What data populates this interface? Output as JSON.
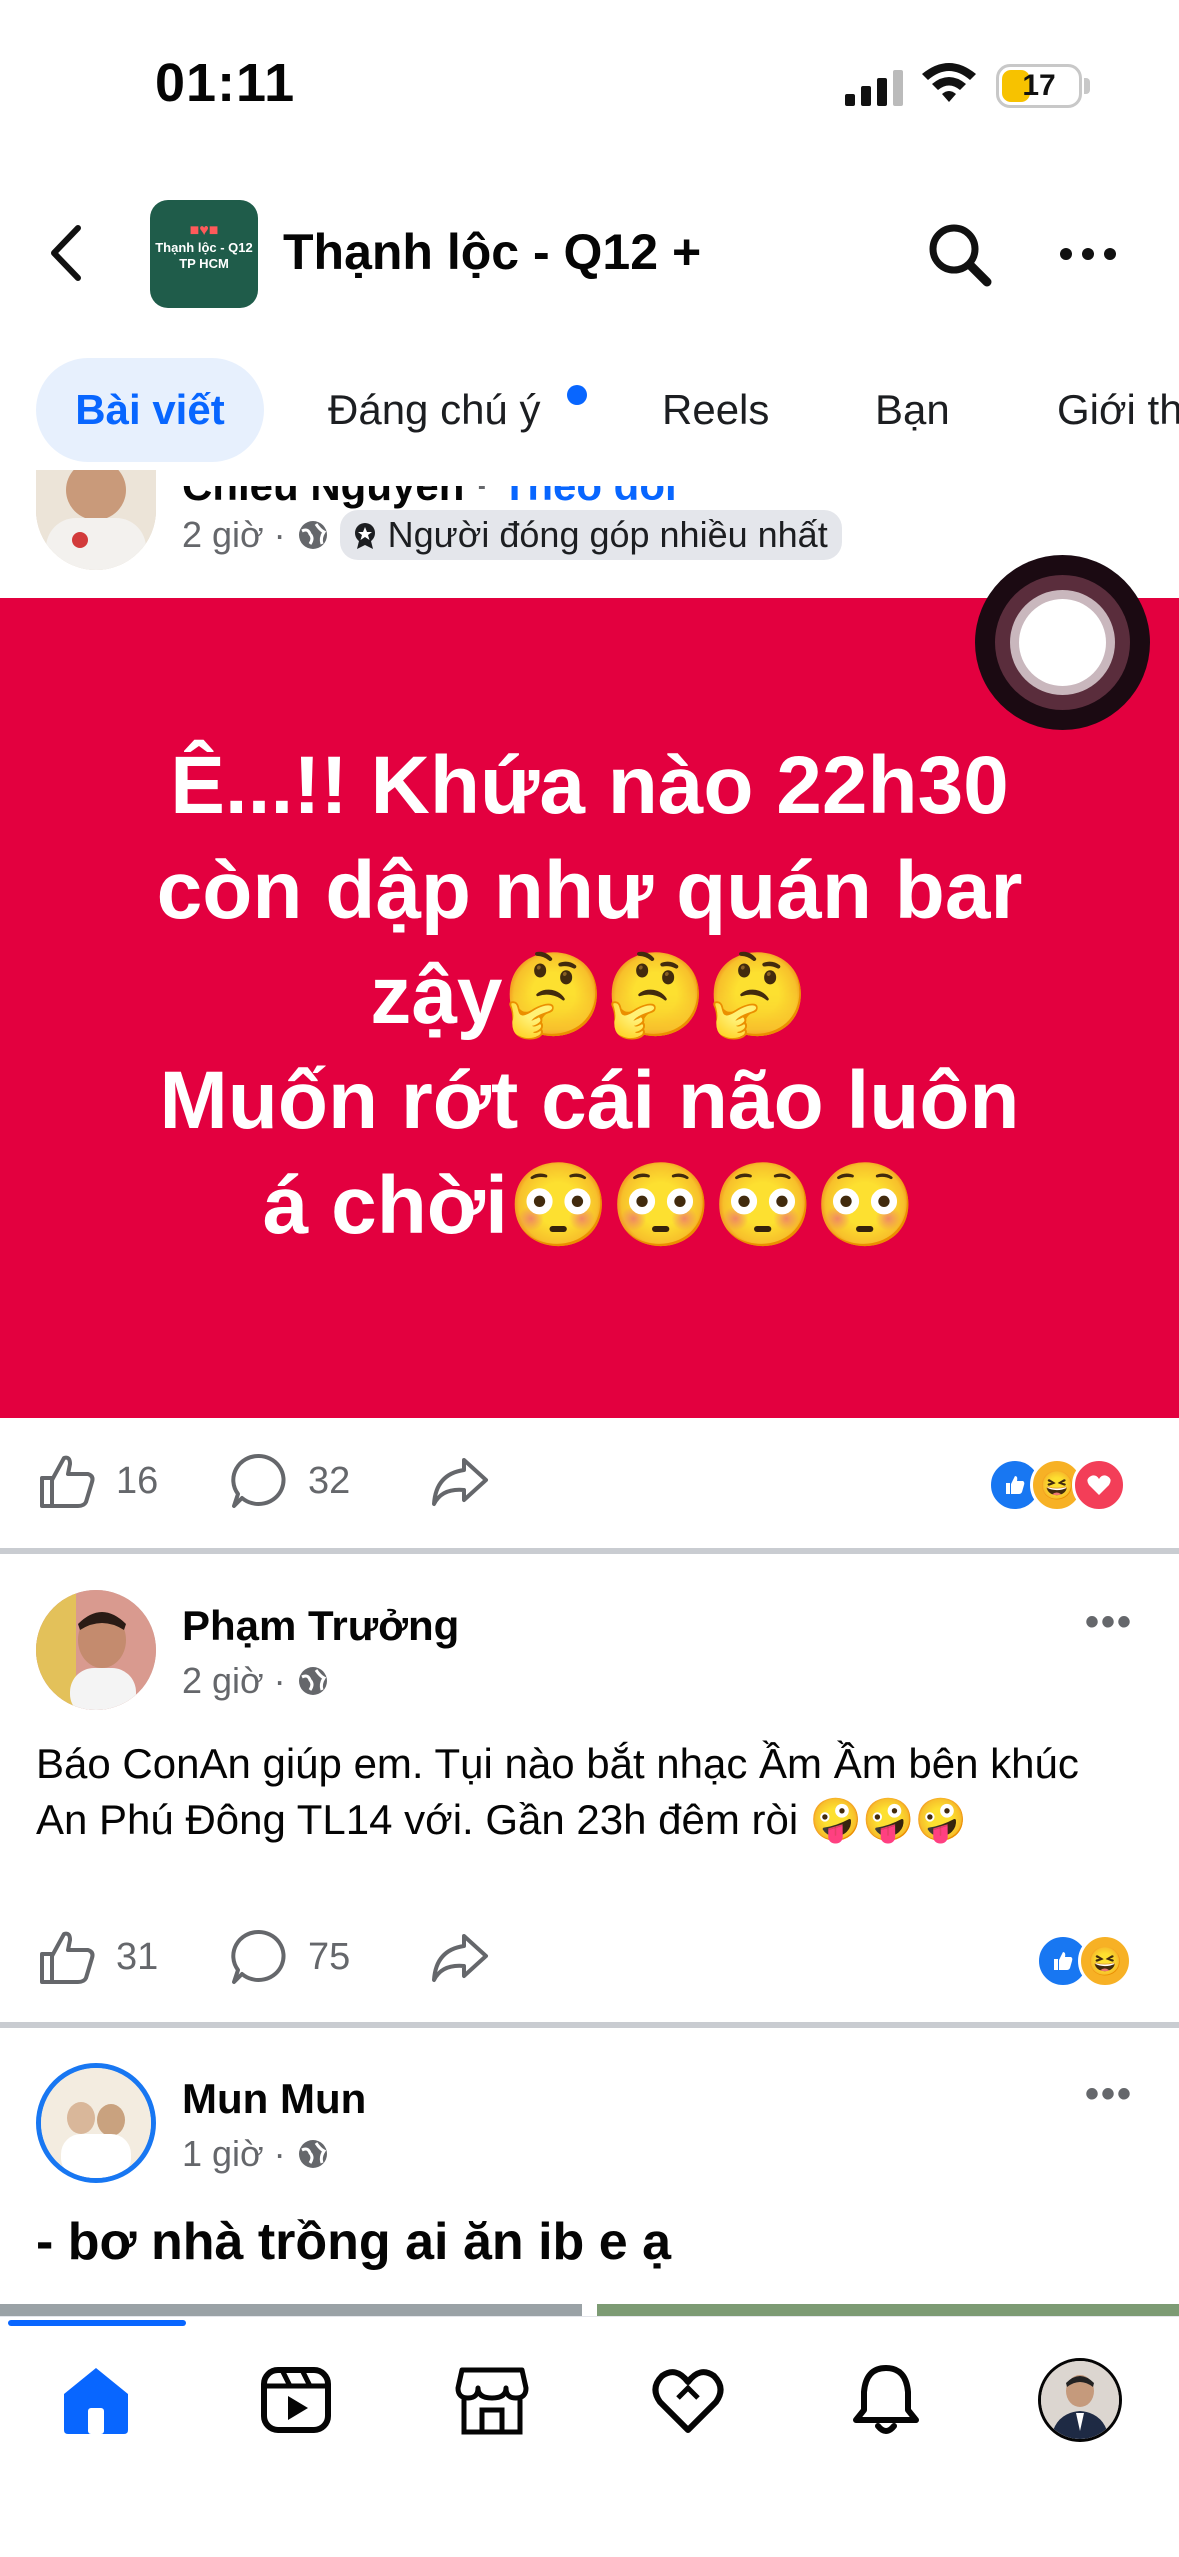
{
  "status": {
    "time": "01:11",
    "battery": "17"
  },
  "header": {
    "group_logo_lines": [
      "Thạnh lộc - Q12",
      "TP HCM"
    ],
    "group_name": "Thạnh lộc - Q12 +"
  },
  "tabs": [
    {
      "label": "Bài viết",
      "active": true
    },
    {
      "label": "Đáng chú ý",
      "has_dot": true
    },
    {
      "label": "Reels"
    },
    {
      "label": "Bạn"
    },
    {
      "label": "Giới th"
    }
  ],
  "posts": [
    {
      "author": "Chiều Nguyễn",
      "follow": "Theo dõi",
      "time": "2 giờ",
      "badge": "Người đóng góp nhiều nhất",
      "card_lines": [
        "Ê...!! Khứa nào 22h30",
        "còn dập như quán bar",
        "zậy🤔🤔🤔",
        "Muốn rớt cái não luôn",
        "á chời😳😳😳😳"
      ],
      "card_color": "#e3003f",
      "likes": "16",
      "comments": "32",
      "reactions": [
        "like",
        "haha",
        "love"
      ]
    },
    {
      "author": "Phạm Trưởng",
      "time": "2 giờ",
      "text": "Báo ConAn giúp em. Tụi nào bắt nhạc Ầm Ầm bên khúc An Phú Đông TL14 với. Gần 23h đêm ròi 🤪🤪🤪",
      "likes": "31",
      "comments": "75",
      "reactions": [
        "like",
        "haha"
      ]
    },
    {
      "author": "Mun Mun",
      "time": "1 giờ",
      "text": "- bơ nhà trồng ai ăn ib e ạ"
    }
  ],
  "nav": {
    "items": [
      "home-icon",
      "video-icon",
      "marketplace-icon",
      "dating-heart-icon",
      "bell-icon",
      "profile-avatar"
    ],
    "accent": "#0866ff"
  }
}
